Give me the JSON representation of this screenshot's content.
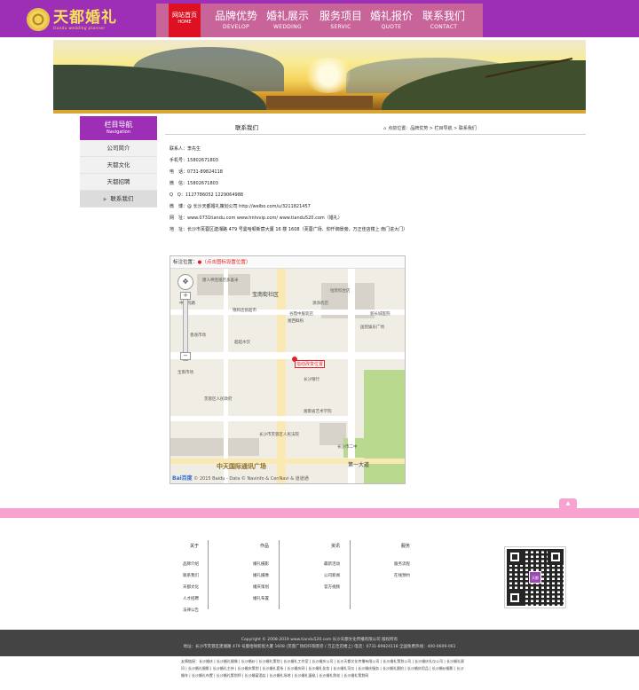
{
  "brand": {
    "name": "天都婚礼",
    "tagline": "tiandu wedding planner",
    "colors": {
      "header": "#9d2fb6",
      "nav": "#c9649a",
      "home": "#dd1122",
      "band": "#f7a2cf"
    }
  },
  "nav": {
    "home": {
      "cn": "网站首页",
      "en": "HOME"
    },
    "items": [
      {
        "cn": "品牌优势",
        "en": "DEVELOP"
      },
      {
        "cn": "婚礼展示",
        "en": "WEDDING"
      },
      {
        "cn": "服务项目",
        "en": "SERVIC"
      },
      {
        "cn": "婚礼报价",
        "en": "QUOTE"
      },
      {
        "cn": "联系我们",
        "en": "CONTACT"
      }
    ]
  },
  "sidebar": {
    "title_cn": "栏目导航",
    "title_en": "Navigation",
    "items": [
      {
        "label": "公司简介"
      },
      {
        "label": "天都文化"
      },
      {
        "label": "天都招聘"
      },
      {
        "label": "联系我们",
        "marker": "▶"
      }
    ]
  },
  "content": {
    "title": "联系我们",
    "breadcrumb": "点前位置：品牌优势 > 栏目导航 > 联系我们",
    "lines": [
      "联系人：李先生",
      "手机号：15802671803",
      "电　话：0731-89824118",
      "微　信：15802671803",
      "Q　Q：1127786052  1229064988",
      "微　博：@ 长沙天都婚礼策划公司   http://weibo.com/u/3211821457",
      "网　址：www.0731tiandu.com  www.hntvvip.com/  www.tiandu520.com（婚礼）",
      "地　址：长沙市芙蓉区建湘路 479 号曼哈顿新宸大厦 16 楼 1608（芙蓉广场、仰仟御景旁，万正佳店楼上 南门进大门）"
    ]
  },
  "map": {
    "header_label": "标注位置：",
    "header_hint": "（点击图标设置位置）",
    "pin_label": "指动改变位置",
    "pois": [
      "唐人神连锁店多喜米",
      "宝南街社区",
      "锦和连锁超市",
      "恒欣综合店",
      "谷鼎中服装店",
      "中医院路",
      "湘西鲜粉",
      "源添药店",
      "新长城医院",
      "超超水饮",
      "香逸市场",
      "国贸娱乐广场",
      "宝南市场",
      "长沙银行",
      "湘南省艺术学院",
      "长沙市芙蓉区人民法院",
      "长沙市二中",
      "第一大道",
      "中天国际通讯广场",
      "芙蓉区人民政府"
    ],
    "footer": "© 2015 Baidu - Data © Navinfo & CenNavi & 道道通",
    "baidu": "Bai百度"
  },
  "band": {
    "top_icon": "▲"
  },
  "footer": {
    "columns": [
      {
        "head": "关于",
        "links": [
          "品牌介绍",
          "联系我们",
          "天都文化",
          "人才招聘",
          "法律公告"
        ]
      },
      {
        "head": "作品",
        "links": [
          "婚礼摄影",
          "婚礼摄像",
          "婚庆策划",
          "婚礼布置"
        ]
      },
      {
        "head": "资讯",
        "links": [
          "最新活动",
          "公司新闻",
          "官方视频"
        ]
      },
      {
        "head": "服务",
        "links": [
          "服务流程",
          "在线预约"
        ]
      }
    ],
    "qr_badge": "天都",
    "copyright": "Copyright © 2008-2019 www.tiandu520.com 长沙天都文化传播有限公司 版权所有",
    "address": "地址：长沙市芙蓉区建湘路 479 号曼哈顿新宸大厦 1608 (芙蓉广场仰仟御景旁 / 万正佳店楼上) 电话：0731-89824118 全国免费热线：400-0609-061",
    "friends": "友情链接：长沙婚庆 | 长沙婚礼摄像 | 长沙婚纱 | 长沙婚礼策划 | 长沙婚礼工作室 | 长沙婚庆公司 | 长沙天都文化传播有限公司 | 长沙婚礼策划公司 | 长沙婚庆礼仪公司 | 长沙婚礼顾问 | 长沙婚礼摄影 | 长沙婚礼主持 | 长沙婚庆策划 | 长沙婚礼套系 | 长沙婚庆网 | 长沙婚礼化妆 | 长沙婚礼司仪 | 长沙婚庆服务 | 长沙婚礼跟拍 | 长沙婚庆用品 | 长沙婚纱摄影 | 长沙婚车 | 长沙婚礼布置 | 长沙婚礼策划师 | 长沙婚宴酒店 | 长沙婚礼场地 | 长沙婚礼蛋糕 | 长沙婚礼鲜花 | 长沙婚礼策划网"
  }
}
